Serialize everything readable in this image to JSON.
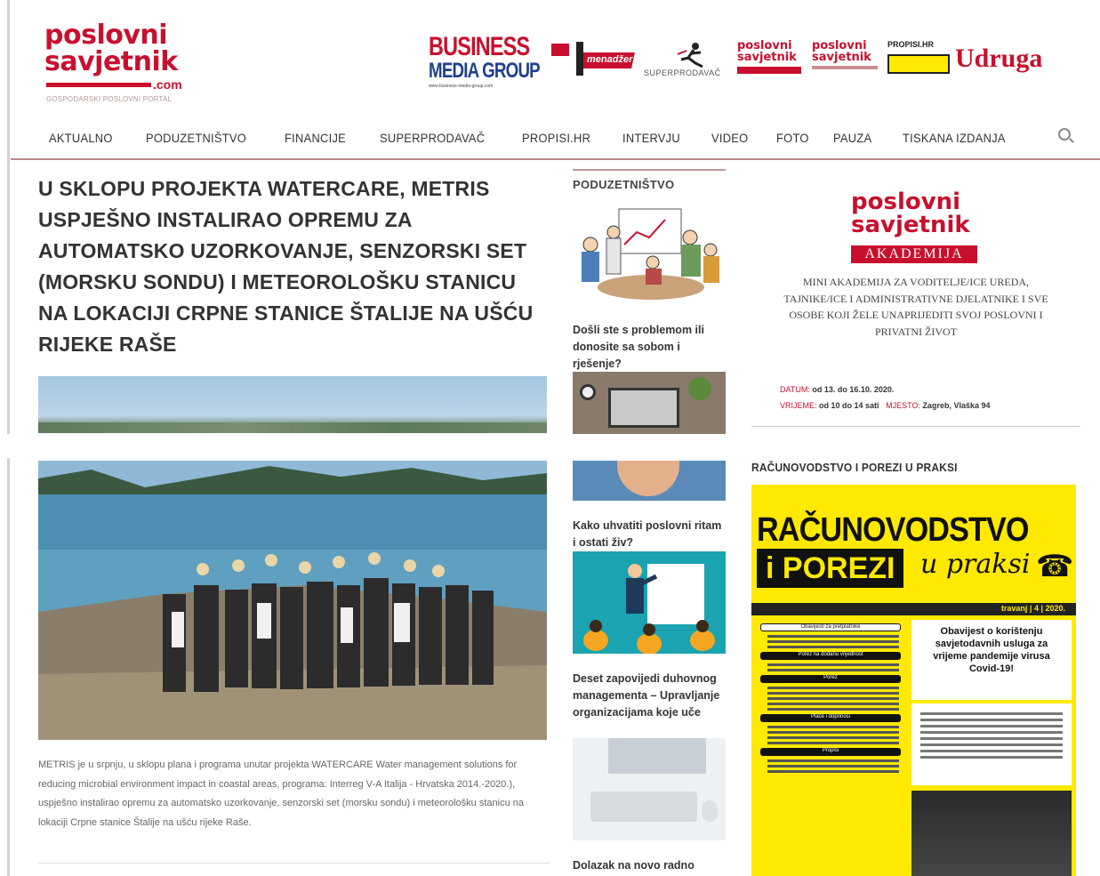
{
  "header": {
    "logo": {
      "line1": "poslovni",
      "line2": "savjetnik",
      "suffix": ".com",
      "tagline": "GOSPODARSKI POSLOVNI PORTAL"
    },
    "partners": [
      {
        "name": "BUSINESS MEDIA GROUP",
        "line1": "BUSINESS",
        "line2": "MEDIA GROUP",
        "url": "www.business-media-group.com"
      },
      {
        "name": "menadžer",
        "line1": "menadžer"
      },
      {
        "name": "superprodavač",
        "line1": "SUPERPRODAVAČ"
      },
      {
        "name": "poslovni savjetnik akademija",
        "line1": "poslovni",
        "line2": "savjetnik"
      },
      {
        "name": "poslovni savjetnik TISKANA IZDANJA",
        "line1": "poslovni",
        "line2": "savjetnik"
      },
      {
        "name": "propisi.hr",
        "line1": "PROPISI.HR"
      },
      {
        "name": "Udruga",
        "line1": "Udruga"
      }
    ]
  },
  "nav": {
    "items": [
      "AKTUALNO",
      "PODUZETNIŠTVO",
      "FINANCIJE",
      "SUPERPRODAVAČ",
      "PROPISI.HR",
      "INTERVJU",
      "VIDEO",
      "FOTO",
      "PAUZA",
      "TISKANA IZDANJA"
    ]
  },
  "article": {
    "headline": "U SKLOPU PROJEKTA WATERCARE, METRIS USPJEŠNO INSTALIRAO OPREMU ZA AUTOMATSKO UZORKOVANJE, SENZORSKI SET (MORSKU SONDU) I METEOROLOŠKU STANICU NA LOKACIJI CRPNE STANICE ŠTALIJE NA UŠĆU RIJEKE RAŠE",
    "caption": "METRIS je u srpnju, u sklopu plana i programa unutar projekta WATERCARE Water management solutions for reducing microbial environment impact in coastal areas, programa: Interreg V-A Italija - Hrvatska 2014.-2020.), uspješno instalirao opremu za automatsko uzorkovanje, senzorski set (morsku sondu) i meteorološku stanicu na lokaciji Crpne stanice Štalije na ušću rijeke Raše."
  },
  "middle": {
    "heading": "PODUZETNIŠTVO",
    "items": [
      {
        "title": "Došli ste s problemom ili donosite sa sobom i rješenje?"
      },
      {
        "title": "Kako uhvatiti poslovni ritam i ostati živ?"
      },
      {
        "title": "Deset zapovijedi duhovnog managementa – Upravljanje organizacijama koje uče"
      },
      {
        "title": "Dolazak na novo radno"
      }
    ]
  },
  "akademija": {
    "logo1": "poslovni",
    "logo2": "savjetnik",
    "band": "AKADEMIJA",
    "text": "MINI AKADEMIJA ZA VODITELJE/ICE UREDA, TAJNIKE/ICE I ADMINISTRATIVNE DJELATNIKE I SVE OSOBE KOJI ŽELE UNAPRIJEDITI SVOJ POSLOVNI I PRIVATNI ŽIVOT",
    "date_label": "DATUM:",
    "date": "od 13. do 16.10. 2020.",
    "time_label": "VRIJEME:",
    "time": "od 10 do 14 sati",
    "place_label": "MJESTO:",
    "place": "Zagreb, Vlaška 94"
  },
  "racunovodstvo": {
    "heading": "RAČUNOVODSTVO I POREZI U PRAKSI",
    "title1": "RAČUNOVODSTVO",
    "title2": "i POREZI",
    "title3": "u praksi",
    "issue": "travanj | 4 | 2020.",
    "covid_box": "Obavijest o korištenju savjetodavnih usluga za vrijeme pandemije virusa Covid-19!",
    "sections": [
      "Obavijesti za pretplatnike",
      "Porez na dodanu vrijednost",
      "Porez",
      "Plaće i doprinosi",
      "Propisi"
    ]
  },
  "colors": {
    "brand_red": "#c8102e",
    "yellow": "#ffe900"
  }
}
